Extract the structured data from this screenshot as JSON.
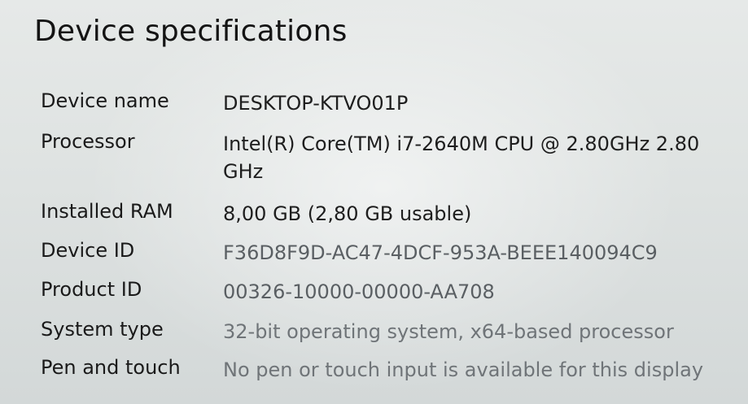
{
  "section_title": "Device specifications",
  "specs": [
    {
      "label": "Device name",
      "value": "DESKTOP-KTVO01P"
    },
    {
      "label": "Processor",
      "value": "Intel(R) Core(TM) i7-2640M CPU @ 2.80GHz   2.80 GHz"
    },
    {
      "label": "Installed RAM",
      "value": "8,00 GB (2,80 GB usable)"
    },
    {
      "label": "Device ID",
      "value": "F36D8F9D-AC47-4DCF-953A-BEEE140094C9"
    },
    {
      "label": "Product ID",
      "value": "00326-10000-00000-AA708"
    },
    {
      "label": "System type",
      "value": "32-bit operating system, x64-based processor"
    },
    {
      "label": "Pen and touch",
      "value": "No pen or touch input is available for this display"
    }
  ]
}
